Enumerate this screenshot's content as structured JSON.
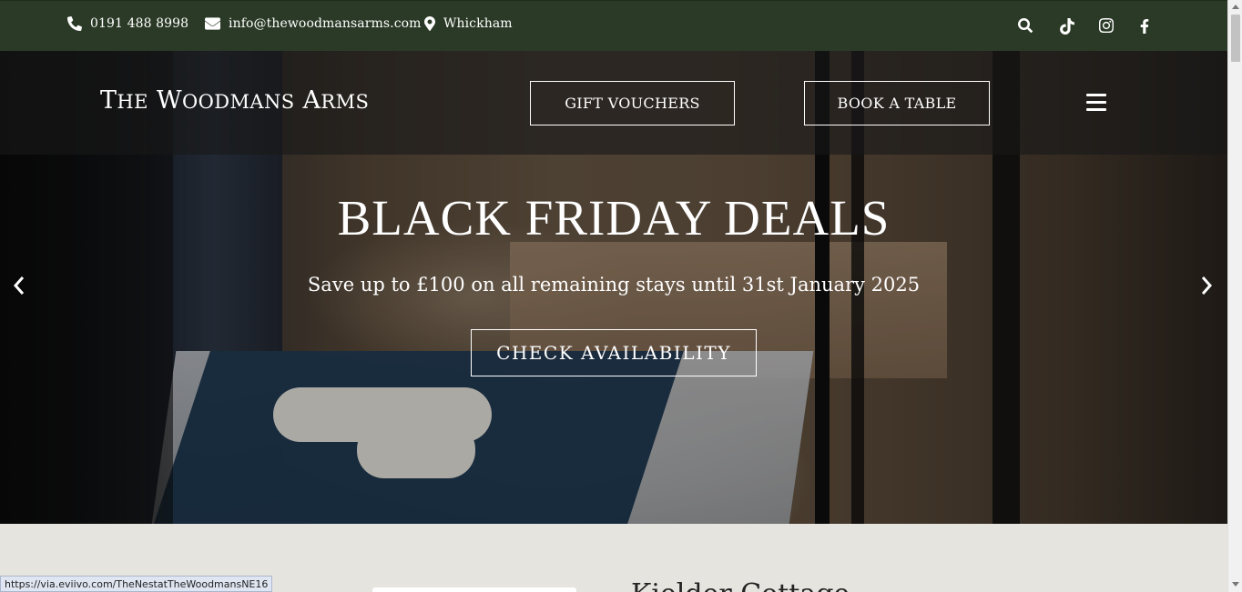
{
  "topbar": {
    "phone": "0191 488 8998",
    "email": "info@thewoodmansarms.com",
    "location": "Whickham",
    "phone_icon": "phone-icon",
    "email_icon": "envelope-icon",
    "location_icon": "map-marker-icon",
    "social": [
      "search-icon",
      "tiktok-icon",
      "instagram-icon",
      "facebook-icon"
    ]
  },
  "header": {
    "logo_parts": {
      "t1": "T",
      "t1s": "HE",
      "w": "W",
      "ws": "OODMANS",
      "a": "A",
      "as": "RMS"
    },
    "gift_vouchers_label": "GIFT VOUCHERS",
    "book_table_label": "BOOK A TABLE",
    "menu_icon": "hamburger-menu-icon"
  },
  "hero": {
    "title": "BLACK FRIDAY DEALS",
    "subtitle": "Save up to £100 on all remaining stays until 31st January 2025",
    "cta_label": "CHECK AVAILABILITY",
    "prev_icon": "chevron-left-icon",
    "next_icon": "chevron-right-icon"
  },
  "content": {
    "heading": "Kielder Cottage"
  },
  "status": {
    "url": "https://via.eviivo.com/TheNestatTheWoodmansNE16"
  },
  "colors": {
    "topbar_bg": "#2b3a27",
    "page_bg": "#e6e4df"
  }
}
